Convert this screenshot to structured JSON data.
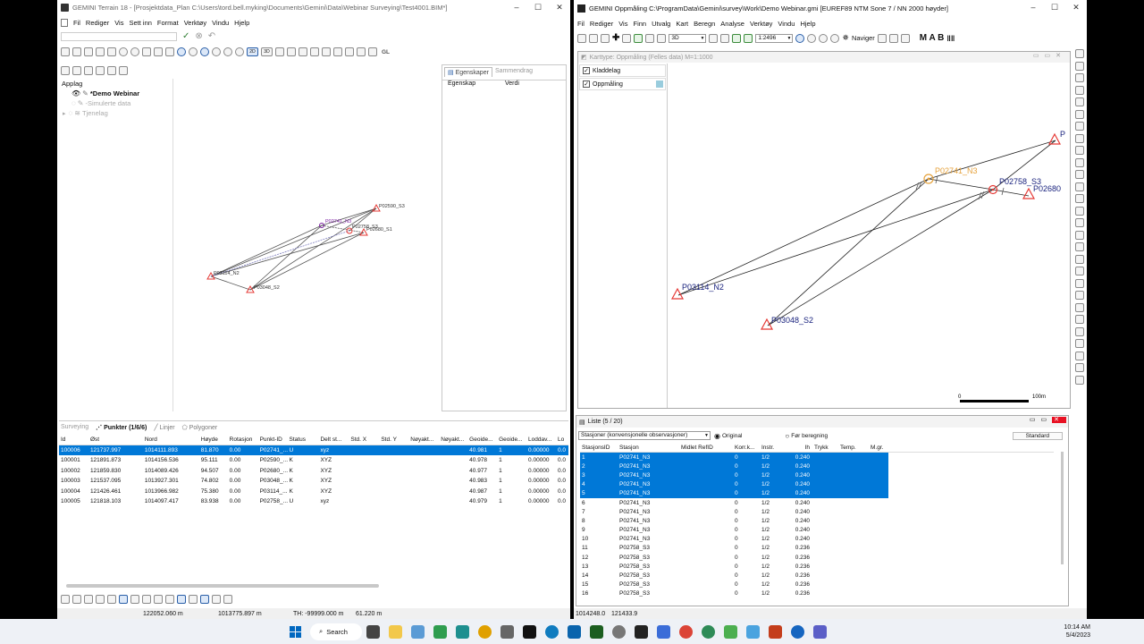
{
  "left_app": {
    "title": "GEMINI Terrain 18 - [Prosjektdata_Plan  C:\\Users\\tord.bell.myking\\Documents\\Gemini\\Data\\Webinar Surveying\\Test4001.BIM*]",
    "menu": [
      "Fil",
      "Rediger",
      "Vis",
      "Sett inn",
      "Format",
      "Verktøy",
      "Vindu",
      "Hjelp"
    ],
    "toolbar2_labels": {
      "d2": "2D",
      "d3": "3D",
      "gl": "GL"
    },
    "layers": {
      "header": "Applag",
      "items": [
        {
          "label": "*Demo Webinar",
          "bold": true
        },
        {
          "label": "-Simulerte data",
          "bold": false
        },
        {
          "label": "Tjenelag",
          "bold": false
        }
      ]
    },
    "props": {
      "tab_active": "Egenskaper",
      "tab_inactive": "Sammendrag",
      "col1": "Egenskap",
      "col2": "Verdi"
    },
    "plot_labels": [
      "P02590_S3",
      "P02741_N3",
      "P02758_S3",
      "P02680_S1",
      "P03114_N2",
      "P03048_S2"
    ],
    "bottom_tabs": [
      "Surveying",
      "Punkter (1/6/6)",
      "Linjer",
      "Polygoner"
    ],
    "table": {
      "headers": [
        "Id",
        "Øst",
        "Nord",
        "Høyde",
        "Rotasjon",
        "Punkt-ID",
        "Status",
        "Delt st...",
        "Std. X",
        "Std. Y",
        "Nøyakt...",
        "Nøyakt...",
        "Geoide...",
        "Geoide...",
        "Loddav...",
        "Lo"
      ],
      "rows": [
        [
          "100006",
          "121737.997",
          "1014111.893",
          "81.870",
          "0.00",
          "P02741_...",
          "U",
          "xyz",
          "",
          "",
          "",
          "",
          "40.981",
          "1",
          "0.00000",
          "0.0"
        ],
        [
          "100001",
          "121891.873",
          "1014156.536",
          "95.111",
          "0.00",
          "P02590_...",
          "K",
          "XYZ",
          "",
          "",
          "",
          "",
          "40.978",
          "1",
          "0.00000",
          "0.0"
        ],
        [
          "100002",
          "121859.830",
          "1014089.426",
          "94.507",
          "0.00",
          "P02680_...",
          "K",
          "XYZ",
          "",
          "",
          "",
          "",
          "40.977",
          "1",
          "0.00000",
          "0.0"
        ],
        [
          "100003",
          "121537.095",
          "1013927.301",
          "74.802",
          "0.00",
          "P03048_...",
          "K",
          "XYZ",
          "",
          "",
          "",
          "",
          "40.983",
          "1",
          "0.00000",
          "0.0"
        ],
        [
          "100004",
          "121426.461",
          "1013966.982",
          "75.380",
          "0.00",
          "P03114_...",
          "K",
          "XYZ",
          "",
          "",
          "",
          "",
          "40.987",
          "1",
          "0.00000",
          "0.0"
        ],
        [
          "100005",
          "121818.103",
          "1014097.417",
          "83.938",
          "0.00",
          "P02758_...",
          "U",
          "xyz",
          "",
          "",
          "",
          "",
          "40.979",
          "1",
          "0.00000",
          "0.0"
        ]
      ]
    },
    "status": {
      "x": "122052.060 m",
      "y": "1013775.897 m",
      "th": "TH: -99999.000 m",
      "z": "61.220 m"
    }
  },
  "right_app": {
    "title": "GEMINI Oppmåling   C:\\ProgramData\\Gemini\\survey\\Work\\Demo Webinar.gmi  [EUREF89 NTM Sone 7 / NN 2000 høyder]",
    "menu": [
      "Fil",
      "Rediger",
      "Vis",
      "Finn",
      "Utvalg",
      "Kart",
      "Beregn",
      "Analyse",
      "Verktøy",
      "Vindu",
      "Hjelp"
    ],
    "view_select": "3D",
    "scale_select": "1:2496",
    "navigate_label": "Naviger",
    "mab_label": "M A B",
    "map_window_title": "Karttype: Oppmåling (Felles data) M=1:1000",
    "layers": [
      "Kladdelag",
      "Oppmåling"
    ],
    "map_labels": {
      "p03114": "P03114_N2",
      "p03048": "P03048_S2",
      "p02741": "P02741_N3",
      "p02758": "P02758_S3",
      "p02680": "P02680",
      "p02590": "P"
    },
    "scalebar": {
      "start": "0",
      "end": "100m"
    },
    "list": {
      "title": "Liste (5 / 20)",
      "select": "Stasjoner (konvensjonelle observasjoner)",
      "radio_original": "Original",
      "radio_before": "Før beregning",
      "standard_button": "Standard",
      "headers": [
        "StasjonsID",
        "Stasjon",
        "Midlet RefID",
        "Korr.k...",
        "Instr.",
        "Ih",
        "Trykk",
        "Temp.",
        "M.gr."
      ],
      "rows": [
        [
          "1",
          "P02741_N3",
          "",
          "0",
          "1/2",
          "0.240",
          "",
          "",
          ""
        ],
        [
          "2",
          "P02741_N3",
          "",
          "0",
          "1/2",
          "0.240",
          "",
          "",
          ""
        ],
        [
          "3",
          "P02741_N3",
          "",
          "0",
          "1/2",
          "0.240",
          "",
          "",
          ""
        ],
        [
          "4",
          "P02741_N3",
          "",
          "0",
          "1/2",
          "0.240",
          "",
          "",
          ""
        ],
        [
          "5",
          "P02741_N3",
          "",
          "0",
          "1/2",
          "0.240",
          "",
          "",
          ""
        ],
        [
          "6",
          "P02741_N3",
          "",
          "0",
          "1/2",
          "0.240",
          "",
          "",
          ""
        ],
        [
          "7",
          "P02741_N3",
          "",
          "0",
          "1/2",
          "0.240",
          "",
          "",
          ""
        ],
        [
          "8",
          "P02741_N3",
          "",
          "0",
          "1/2",
          "0.240",
          "",
          "",
          ""
        ],
        [
          "9",
          "P02741_N3",
          "",
          "0",
          "1/2",
          "0.240",
          "",
          "",
          ""
        ],
        [
          "10",
          "P02741_N3",
          "",
          "0",
          "1/2",
          "0.240",
          "",
          "",
          ""
        ],
        [
          "11",
          "P02758_S3",
          "",
          "0",
          "1/2",
          "0.236",
          "",
          "",
          ""
        ],
        [
          "12",
          "P02758_S3",
          "",
          "0",
          "1/2",
          "0.236",
          "",
          "",
          ""
        ],
        [
          "13",
          "P02758_S3",
          "",
          "0",
          "1/2",
          "0.236",
          "",
          "",
          ""
        ],
        [
          "14",
          "P02758_S3",
          "",
          "0",
          "1/2",
          "0.236",
          "",
          "",
          ""
        ],
        [
          "15",
          "P02758_S3",
          "",
          "0",
          "1/2",
          "0.236",
          "",
          "",
          ""
        ],
        [
          "16",
          "P02758_S3",
          "",
          "0",
          "1/2",
          "0.236",
          "",
          "",
          ""
        ]
      ],
      "selected_count": 5
    },
    "status": {
      "x": "1014248.0",
      "y": "121433.9"
    }
  },
  "taskbar": {
    "search": "Search",
    "time": "10:14 AM",
    "date": "5/4/2023"
  },
  "colors": {
    "selection": "#0078d7",
    "marker": "#e53935",
    "label": "#1a237e",
    "station": "#e6a23c"
  }
}
